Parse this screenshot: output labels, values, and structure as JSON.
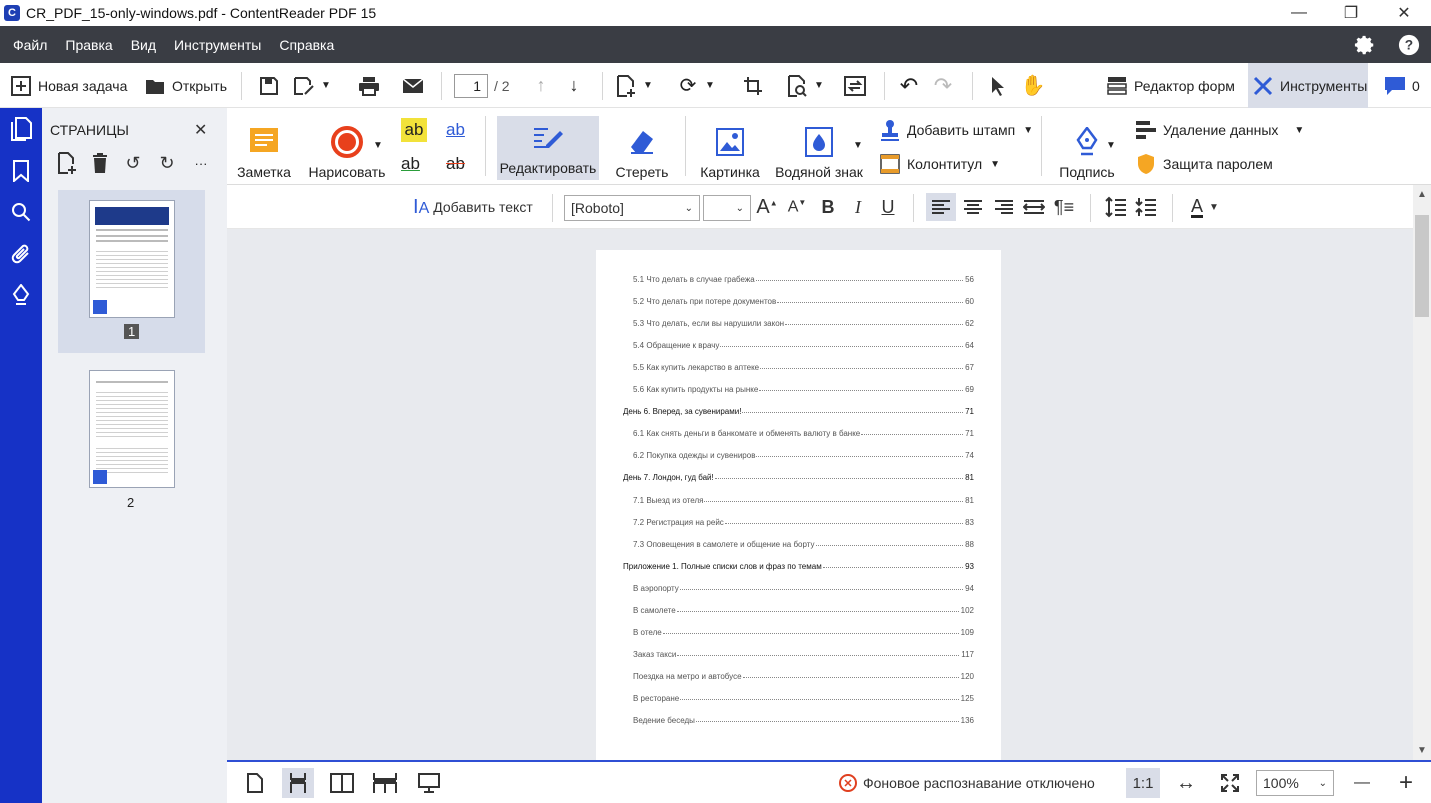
{
  "window": {
    "title": "CR_PDF_15-only-windows.pdf - ContentReader PDF 15",
    "app_icon": "C",
    "controls": {
      "minimize": "—",
      "restore": "❐",
      "close": "✕"
    }
  },
  "menu": {
    "items": [
      "Файл",
      "Правка",
      "Вид",
      "Инструменты",
      "Справка"
    ],
    "icons": [
      "gear-icon",
      "help-icon"
    ]
  },
  "toolbar": {
    "new_task": "Новая задача",
    "open": "Открыть",
    "page_current": "1",
    "page_total": "/ 2",
    "form_editor": "Редактор форм",
    "tools": "Инструменты",
    "comments_count": "0"
  },
  "sidebar": {
    "title": "СТРАНИЦЫ",
    "close": "✕",
    "more": "···",
    "pages": [
      {
        "number": "1",
        "selected": true
      },
      {
        "number": "2",
        "selected": false
      }
    ]
  },
  "ribbon": {
    "note": "Заметка",
    "draw": "Нарисовать",
    "hl_ab_1": "ab",
    "hl_ab_2": "ab",
    "hl_ab_3": "ab",
    "hl_ab_4": "ab",
    "edit": "Редактировать",
    "erase": "Стереть",
    "picture": "Картинка",
    "watermark": "Водяной знак",
    "add_stamp": "Добавить штамп",
    "header_footer": "Колонтитул",
    "signature": "Подпись",
    "redaction": "Удаление данных",
    "password": "Защита паролем"
  },
  "format_bar": {
    "add_text": "Добавить текст",
    "font": "[Roboto]",
    "font_size": "",
    "bold": "B",
    "italic": "I",
    "underline": "U",
    "color_label": "A"
  },
  "document": {
    "toc": [
      {
        "label": "5.1 Что делать в случае грабежа",
        "page": "56",
        "level": 2
      },
      {
        "label": "5.2 Что делать при потере документов",
        "page": "60",
        "level": 2
      },
      {
        "label": "5.3 Что делать, если вы нарушили закон",
        "page": "62",
        "level": 2
      },
      {
        "label": "5.4 Обращение к врачу",
        "page": "64",
        "level": 2
      },
      {
        "label": "5.5 Как купить лекарство в аптеке",
        "page": "67",
        "level": 2
      },
      {
        "label": "5.6 Как купить продукты на рынке",
        "page": "69",
        "level": 2
      },
      {
        "label": "День 6. Вперед, за сувенирами!",
        "page": "71",
        "level": 1
      },
      {
        "label": "6.1 Как снять деньги в банкомате и обменять валюту в банке",
        "page": "71",
        "level": 2
      },
      {
        "label": "6.2 Покупка одежды и сувениров",
        "page": "74",
        "level": 2
      },
      {
        "label": "День 7. Лондон, гуд бай!",
        "page": "81",
        "level": 1
      },
      {
        "label": "7.1 Выезд из отеля",
        "page": "81",
        "level": 2
      },
      {
        "label": "7.2 Регистрация на рейс",
        "page": "83",
        "level": 2
      },
      {
        "label": "7.3 Оповещения в самолете и общение на борту",
        "page": "88",
        "level": 2
      },
      {
        "label": "Приложение 1. Полные списки слов и фраз по темам",
        "page": "93",
        "level": 1
      },
      {
        "label": "В аэропорту",
        "page": "94",
        "level": 2
      },
      {
        "label": "В самолете",
        "page": "102",
        "level": 2
      },
      {
        "label": "В отеле",
        "page": "109",
        "level": 2
      },
      {
        "label": "Заказ такси",
        "page": "117",
        "level": 2
      },
      {
        "label": "Поездка на метро и автобусе",
        "page": "120",
        "level": 2
      },
      {
        "label": "В ресторане",
        "page": "125",
        "level": 2
      },
      {
        "label": "Ведение беседы",
        "page": "136",
        "level": 2
      }
    ]
  },
  "statusbar": {
    "ocr_status": "Фоновое распознавание отключено",
    "actual_size": "1:1",
    "zoom": "100%",
    "zoom_out": "—",
    "zoom_in": "+"
  },
  "colors": {
    "accent_blue": "#1632c6",
    "menubar": "#3a3d44",
    "note_orange": "#f5a623",
    "draw_red": "#e8401c"
  }
}
